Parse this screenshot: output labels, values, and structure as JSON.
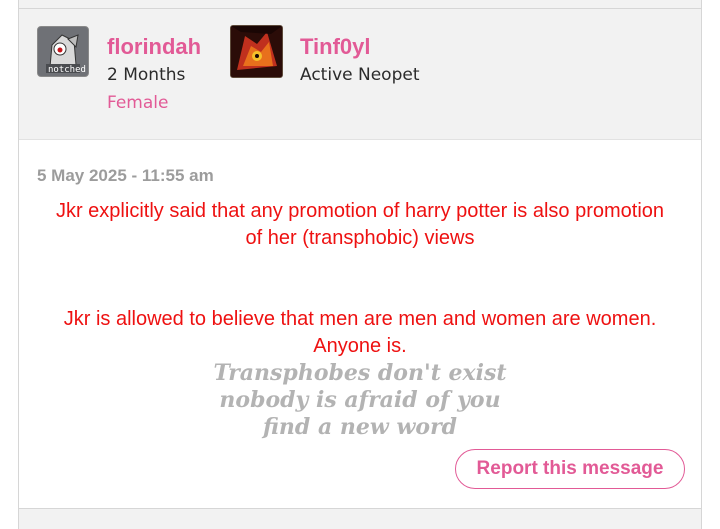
{
  "author": {
    "username": "florindah",
    "membership_duration": "2 Months",
    "gender": "Female",
    "avatar_label": "notched"
  },
  "active_pet": {
    "name": "Tinf0yl",
    "status": "Active Neopet"
  },
  "message": {
    "timestamp": "5 May 2025 - 11:55 am",
    "paragraph_1": "Jkr explicitly said that any promotion of harry potter is also promotion of her (transphobic) views",
    "paragraph_2": "Jkr is allowed to believe that men are men and women are women. Anyone is.",
    "signature_lines": [
      "Transphobes don't exist",
      "nobody is afraid of you",
      "find a new word"
    ]
  },
  "actions": {
    "report_label": "Report this message"
  },
  "colors": {
    "accent": "#e25a96",
    "message_text": "#ee1111",
    "signature": "#b3b3b3",
    "header_bg": "#f2f2f2"
  }
}
